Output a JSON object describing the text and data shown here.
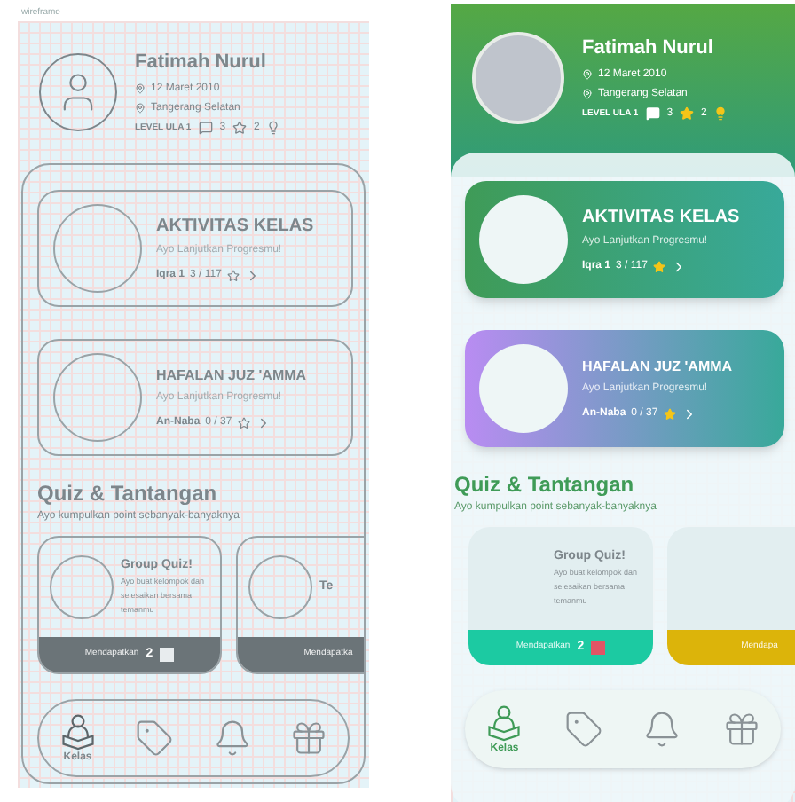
{
  "frames": [
    {
      "kind": "wireframe",
      "label": "wireframe",
      "profile": {
        "name": "Fatimah Nurul",
        "birth_date": "12 Maret 2010",
        "city": "Tangerang Selatan",
        "level": "LEVEL ULA 1",
        "stars": "3",
        "lamps": "2"
      },
      "activities": [
        {
          "title": "AKTIVITAS KELAS",
          "subtitle": "Ayo Lanjutkan Progresmu!",
          "book": "Iqra 1",
          "progress": "3 / 117"
        },
        {
          "title": "HAFALAN JUZ 'AMMA",
          "subtitle": "Ayo Lanjutkan Progresmu!",
          "book": "An-Naba",
          "progress": "0 / 37"
        }
      ],
      "quiz": {
        "title": "Quiz & Tantangan",
        "subtitle": "Ayo kumpulkan point sebanyak-banyaknya",
        "cards": [
          {
            "title": "Group Quiz!",
            "description": "Ayo buat kelompok dan selesaikan bersama temanmu",
            "reward_label": "Mendapatkan",
            "points": "2"
          },
          {
            "title": "Te",
            "reward_label": "Mendapatka"
          }
        ]
      },
      "nav": [
        {
          "kind": "reader",
          "label": "Kelas",
          "selected": true
        },
        {
          "kind": "badge",
          "selected": false
        },
        {
          "kind": "bell",
          "selected": false
        },
        {
          "kind": "gift",
          "selected": false
        }
      ]
    },
    {
      "kind": "colored",
      "profile": {
        "name": "Fatimah Nurul",
        "birth_date": "12 Maret 2010",
        "city": "Tangerang Selatan",
        "level": "LEVEL ULA 1",
        "stars": "3",
        "lamps": "2"
      },
      "activities": [
        {
          "title": "AKTIVITAS KELAS",
          "subtitle": "Ayo Lanjutkan Progresmu!",
          "book": "Iqra 1",
          "progress": "3 / 117",
          "color": "#3f9b57"
        },
        {
          "title": "HAFALAN JUZ 'AMMA",
          "subtitle": "Ayo Lanjutkan Progresmu!",
          "book": "An-Naba",
          "progress": "0 / 37",
          "color": "#b98cf2"
        }
      ],
      "quiz": {
        "title": "Quiz & Tantangan",
        "subtitle": "Ayo kumpulkan point sebanyak-banyaknya",
        "cards": [
          {
            "title": "Group Quiz!",
            "description": "Ayo buat kelompok dan selesaikan bersama temanmu",
            "reward_label": "Mendapatkan",
            "points": "2",
            "color": "#1ccaa2"
          },
          {
            "reward_label": "Mendapa",
            "color": "#dcb40a"
          }
        ]
      },
      "nav": [
        {
          "kind": "reader",
          "label": "Kelas",
          "selected": true
        },
        {
          "kind": "badge",
          "selected": false
        },
        {
          "kind": "bell",
          "selected": false
        },
        {
          "kind": "gift",
          "selected": false
        }
      ]
    }
  ]
}
